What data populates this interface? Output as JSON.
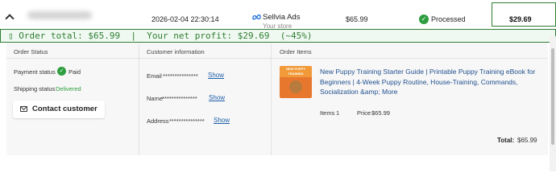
{
  "order_row": {
    "date": "2026-02-04 22:30:14",
    "store_name": "Sellvia Ads",
    "store_sub": "Your store",
    "amount": "$65.99",
    "status": "Processed",
    "net_profit": "$29.69"
  },
  "banner": {
    "text": "Order total: $65.99  |  Your net profit: $29.69  (~45%)"
  },
  "order_status": {
    "title": "Order Status",
    "payment_label": "Payment status",
    "payment_value": "Paid",
    "shipping_label": "Shipping status",
    "shipping_value": "Delivered",
    "contact_button": "Contact customer"
  },
  "customer_info": {
    "title": "Customer information",
    "email_label": "Email",
    "name_label": "Name",
    "address_label": "Address",
    "masked": "***************",
    "show_label": "Show"
  },
  "order_items": {
    "title": "Order Items",
    "thumb_text": "NEW PUPPY TRAINING",
    "product_title": "New Puppy Training Starter Guide | Printable Puppy Training eBook for Beginners | 4-Week Puppy Routine, House-Training, Commands, Socialization &amp; More",
    "items_label": "Items",
    "items_value": "1",
    "price_label": "Price",
    "price_value": "$65.99",
    "total_label": "Total:",
    "total_value": "$65.99"
  },
  "colors": {
    "accent_green": "#2e7d32",
    "status_green": "#2e9e3f",
    "link_blue": "#1f5fa8"
  }
}
